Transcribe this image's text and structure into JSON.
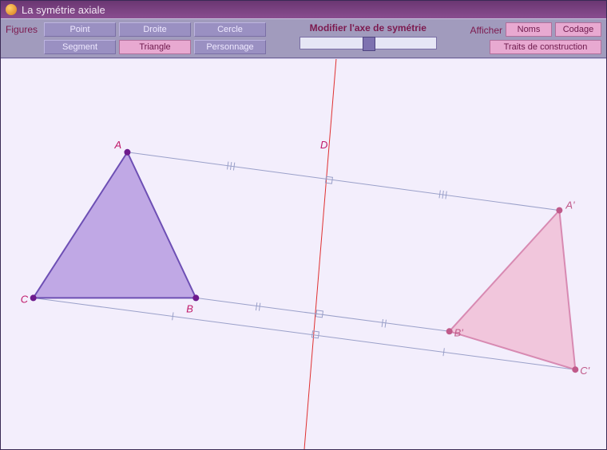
{
  "title": "La symétrie axiale",
  "figures_label": "Figures",
  "btns": {
    "point": "Point",
    "droite": "Droite",
    "cercle": "Cercle",
    "segment": "Segment",
    "triangle": "Triangle",
    "personnage": "Personnage"
  },
  "modifier_label": "Modifier l'axe de symétrie",
  "afficher_label": "Afficher",
  "opts": {
    "noms": "Noms",
    "codage": "Codage",
    "traits": "Traits de construction"
  },
  "labels": {
    "A": "A",
    "B": "B",
    "C": "C",
    "D": "D",
    "Ap": "A'",
    "Bp": "B'",
    "Cp": "C'"
  }
}
